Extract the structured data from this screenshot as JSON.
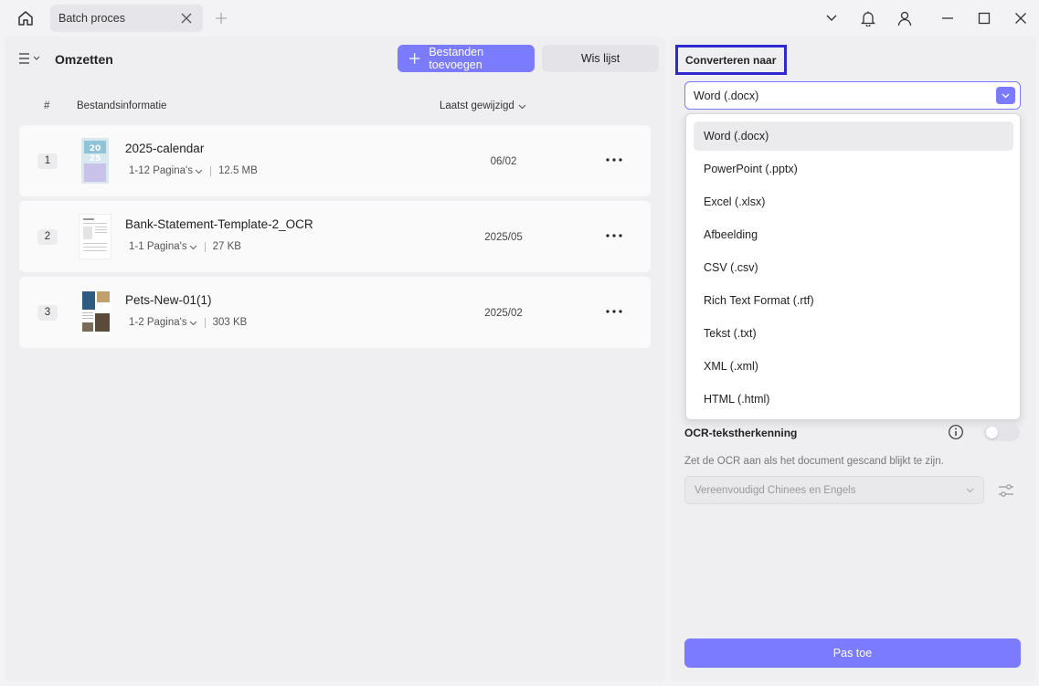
{
  "tab": {
    "label": "Batch proces"
  },
  "header": {
    "title": "Omzetten",
    "add_files_label": "Bestanden toevoegen",
    "clear_list_label": "Wis lijst"
  },
  "columns": {
    "number": "#",
    "file_info": "Bestandsinformatie",
    "last_modified": "Laatst gewijzigd"
  },
  "files": [
    {
      "index": "1",
      "name": "2025-calendar",
      "pages": "1-12 Pagina's",
      "size": "12.5 MB",
      "date": "06/02"
    },
    {
      "index": "2",
      "name": "Bank-Statement-Template-2_OCR",
      "pages": "1-1 Pagina's",
      "size": "27 KB",
      "date": "2025/05"
    },
    {
      "index": "3",
      "name": "Pets-New-01(1)",
      "pages": "1-2 Pagina's",
      "size": "303 KB",
      "date": "2025/02"
    }
  ],
  "convert": {
    "label": "Converteren naar",
    "selected": "Word (.docx)",
    "options": [
      "Word (.docx)",
      "PowerPoint (.pptx)",
      "Excel (.xlsx)",
      "Afbeelding",
      "CSV (.csv)",
      "Rich Text Format (.rtf)",
      "Tekst (.txt)",
      "XML (.xml)",
      "HTML (.html)"
    ]
  },
  "ocr": {
    "title": "OCR-tekstherkenning",
    "description": "Zet de OCR aan als het document gescand blijkt te zijn.",
    "language": "Vereenvoudigd Chinees en Engels",
    "enabled": false
  },
  "apply_label": "Pas toe",
  "colors": {
    "accent": "#7b7bff",
    "highlight_border": "#2d2ad0"
  }
}
